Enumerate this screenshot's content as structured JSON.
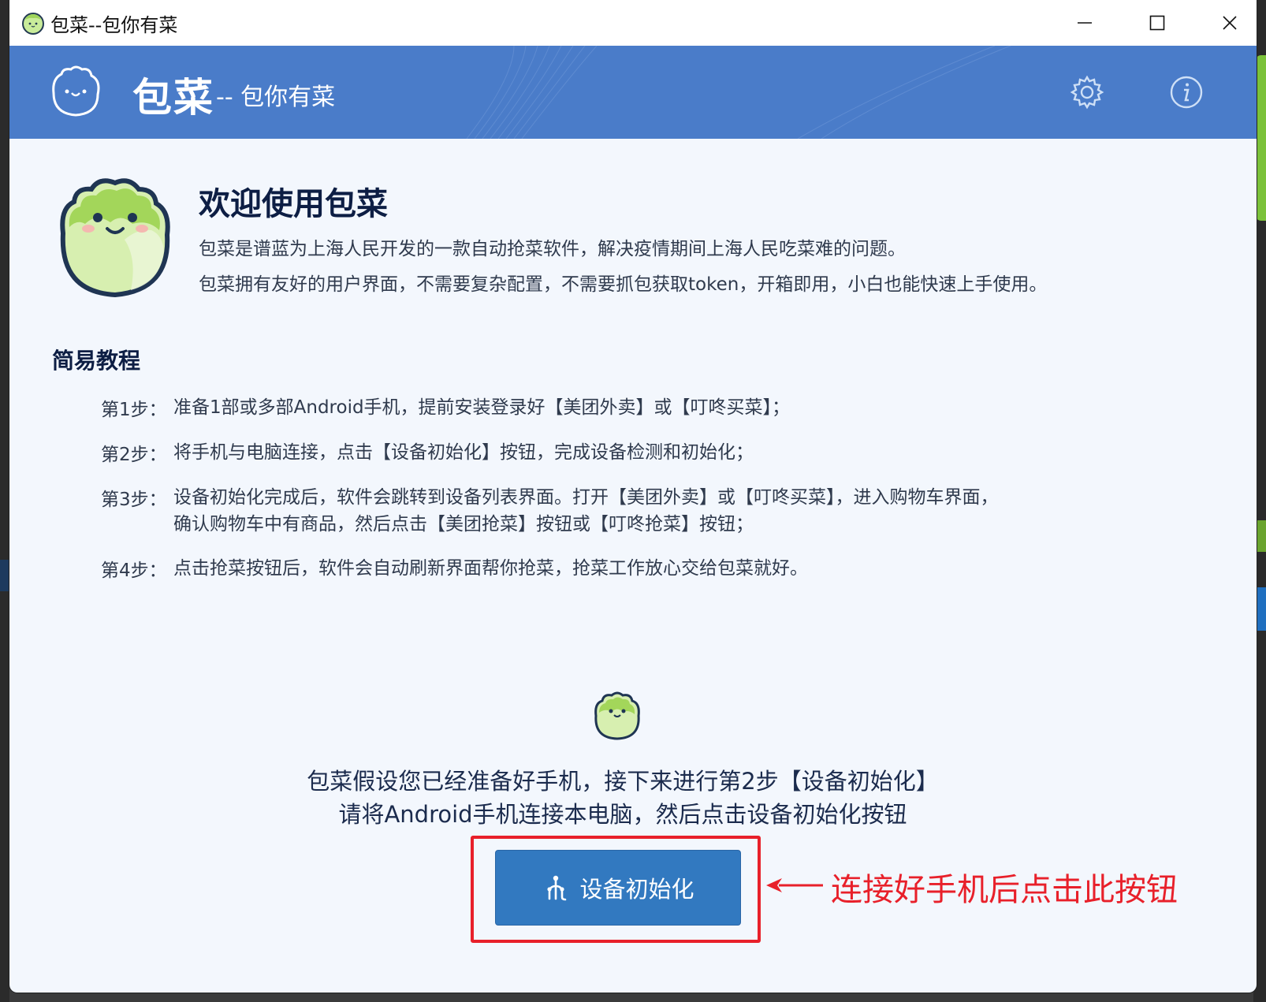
{
  "window": {
    "title": "包菜--包你有菜"
  },
  "header": {
    "brand": "包菜",
    "slogan": "-- 包你有菜"
  },
  "welcome": {
    "title": "欢迎使用包菜",
    "lines": [
      "包菜是谱蓝为上海人民开发的一款自动抢菜软件，解决疫情期间上海人民吃菜难的问题。",
      "包菜拥有友好的用户界面，不需要复杂配置，不需要抓包获取token，开箱即用，小白也能快速上手使用。"
    ]
  },
  "tutorial": {
    "title": "简易教程",
    "steps": [
      {
        "num": "第1步：",
        "lines": [
          "准备1部或多部Android手机，提前安装登录好【美团外卖】或【叮咚买菜】；"
        ]
      },
      {
        "num": "第2步：",
        "lines": [
          "将手机与电脑连接，点击【设备初始化】按钮，完成设备检测和初始化；"
        ]
      },
      {
        "num": "第3步：",
        "lines": [
          "设备初始化完成后，软件会跳转到设备列表界面。打开【美团外卖】或【叮咚买菜】，进入购物车界面，",
          "确认购物车中有商品，然后点击【美团抢菜】按钮或【叮咚抢菜】按钮；"
        ]
      },
      {
        "num": "第4步：",
        "lines": [
          "点击抢菜按钮后，软件会自动刷新界面帮你抢菜，抢菜工作放心交给包菜就好。"
        ]
      }
    ]
  },
  "prompt": {
    "line1": "包菜假设您已经准备好手机，接下来进行第2步【设备初始化】",
    "line2": "请将Android手机连接本电脑，然后点击设备初始化按钮"
  },
  "init_button": {
    "label": "设备初始化",
    "icon": "device-tree-icon"
  },
  "annotation": {
    "text": "连接好手机后点击此按钮",
    "color": "#e8202a"
  },
  "colors": {
    "header": "#4a7cc9",
    "button": "#3279c0",
    "accent_green": "#a8d86e",
    "title_navy": "#0d1e44"
  }
}
